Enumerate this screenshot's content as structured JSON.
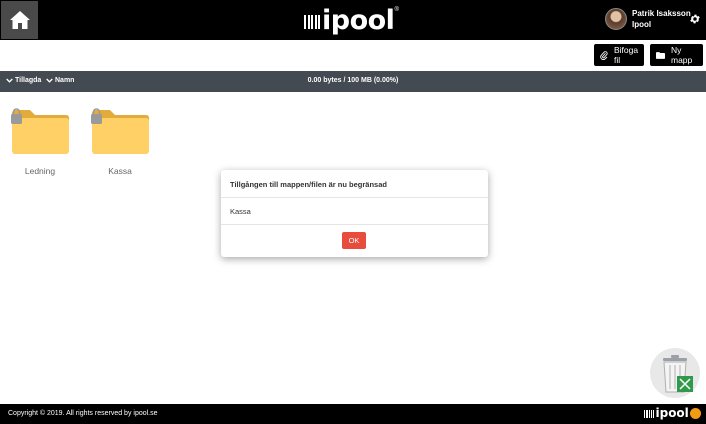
{
  "header": {
    "logo_text": "ipool",
    "logo_reg": "®",
    "user": {
      "name": "Patrik Isaksson",
      "org": "Ipool"
    }
  },
  "actions": {
    "attach_label": "Bifoga fil",
    "new_folder_label": "Ny mapp"
  },
  "toolbar": {
    "sort_added": "Tillagda",
    "sort_name": "Namn",
    "storage": "0.00 bytes / 100 MB (0.00%)"
  },
  "folders": [
    {
      "label": "Ledning"
    },
    {
      "label": "Kassa"
    }
  ],
  "modal": {
    "title": "Tillgången till mappen/filen är nu begränsad",
    "body": "Kassa",
    "ok_label": "OK"
  },
  "footer": {
    "copyright": "Copyright © 2019. All rights reserved by ipool.se",
    "logo_text": "ipool"
  },
  "colors": {
    "header_bg": "#000000",
    "toolbar_bg": "#444a52",
    "folder_yellow": "#ffd066",
    "ok_button": "#e74c3c"
  }
}
